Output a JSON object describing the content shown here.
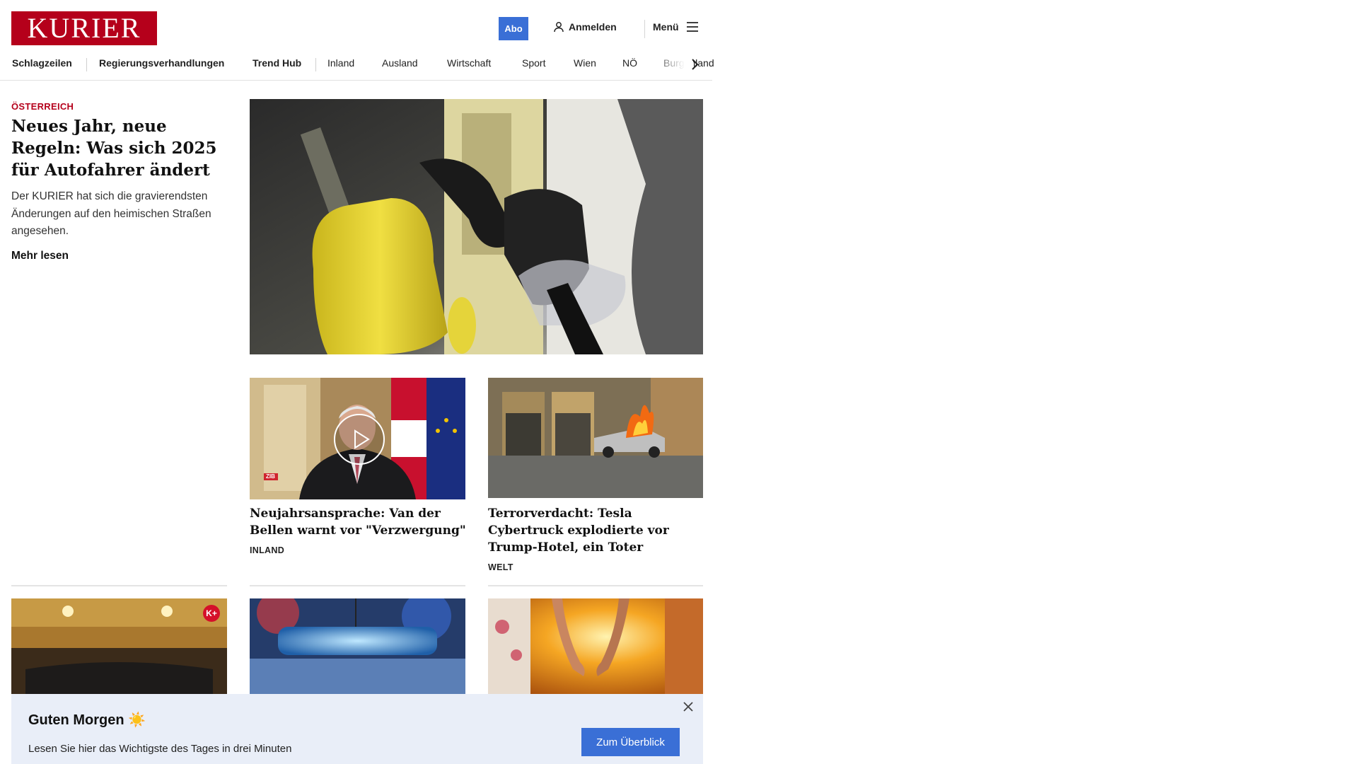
{
  "header": {
    "logo": "KURIER",
    "abo": "Abo",
    "login": "Anmelden",
    "menu": "Menü"
  },
  "nav": {
    "items": [
      "Schlagzeilen",
      "Regierungsverhandlungen",
      "Trend Hub",
      "Inland",
      "Ausland",
      "Wirtschaft",
      "Sport",
      "Wien",
      "NÖ",
      "Burgenland"
    ]
  },
  "lead": {
    "kicker": "ÖSTERREICH",
    "title": "Neues Jahr, neue Regeln: Was sich 2025 für Auto­fahrer ändert",
    "teaser": "Der KURIER hat sich die gravierendsten Änderungen auf den heimischen Straßen angesehen.",
    "more": "Mehr lesen"
  },
  "cards": [
    {
      "title": "Neujahrsansprache: Van der Bellen warnt vor \"Verzwergung\"",
      "category": "INLAND",
      "badge": "ZIB"
    },
    {
      "title": "Terrorverdacht: Tesla Cybertruck explodierte vor Trump-Hotel, ein Toter",
      "category": "WELT"
    }
  ],
  "premium_badge": "K+",
  "banner": {
    "title": "Guten Morgen ☀️",
    "text": "Lesen Sie hier das Wichtigste des Tages in drei Minuten",
    "button": "Zum Überblick"
  },
  "colors": {
    "brand_red": "#b5001b",
    "accent_blue": "#3a6fd6",
    "banner_bg": "#e9eef8"
  }
}
